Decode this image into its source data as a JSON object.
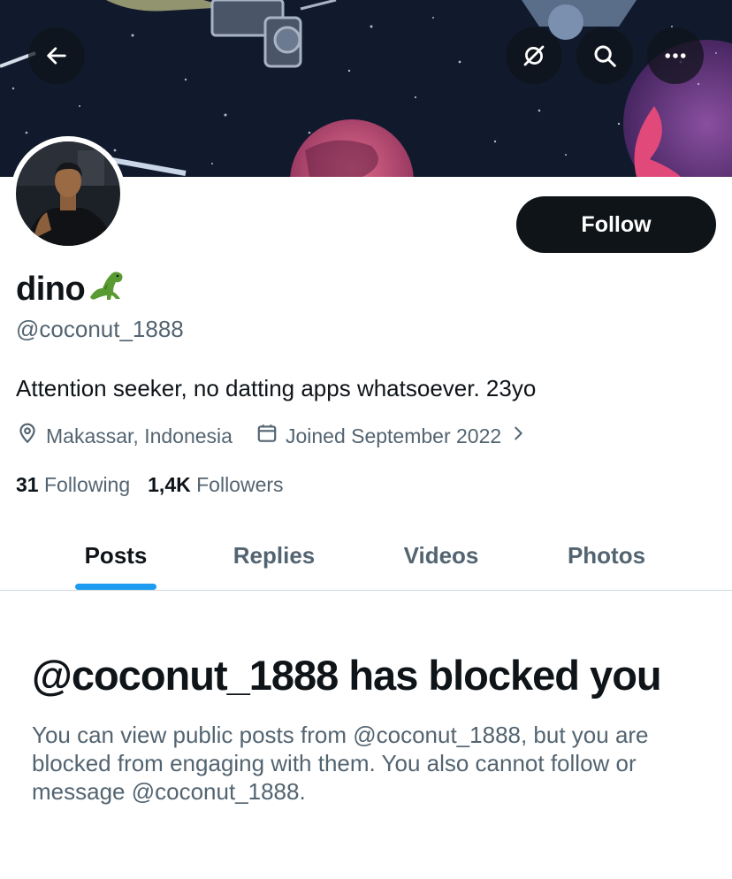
{
  "header": {
    "back_icon": "arrow-left-icon",
    "translate_icon": "no-translate-icon",
    "search_icon": "search-icon",
    "more_icon": "more-horizontal-icon"
  },
  "profile": {
    "display_name": "dino",
    "name_emoji": "🦖",
    "handle": "@coconut_1888",
    "bio": "Attention seeker, no datting apps whatsoever. 23yo",
    "location": "Makassar, Indonesia",
    "joined": "Joined September 2022",
    "follow_label": "Follow",
    "following_count": "31",
    "following_label": "Following",
    "followers_count": "1,4K",
    "followers_label": "Followers"
  },
  "tabs": [
    {
      "label": "Posts",
      "active": true
    },
    {
      "label": "Replies",
      "active": false
    },
    {
      "label": "Videos",
      "active": false
    },
    {
      "label": "Photos",
      "active": false
    }
  ],
  "blocked": {
    "title": "@coconut_1888 has blocked you",
    "message": "You can view public posts from @coconut_1888, but you are blocked from engaging with them. You also cannot follow or message @coconut_1888."
  },
  "colors": {
    "accent": "#1d9bf0",
    "text_primary": "#0f1419",
    "text_secondary": "#536471",
    "follow_bg": "#0f1419"
  }
}
